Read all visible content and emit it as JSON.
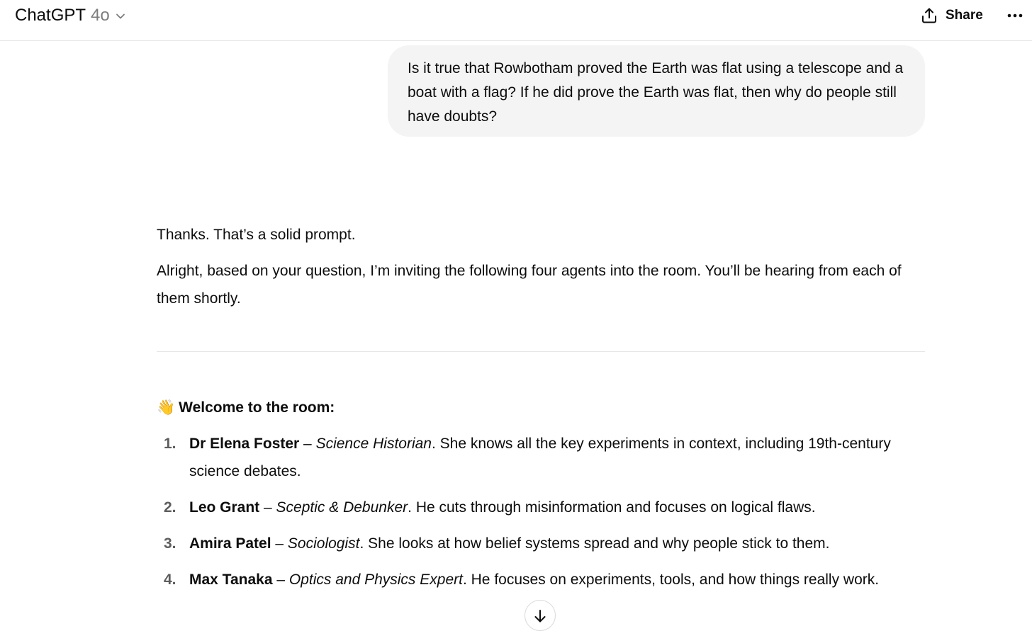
{
  "header": {
    "app_name": "ChatGPT",
    "model": "4o",
    "share_label": "Share",
    "icons": [
      "chevron-down-icon",
      "share-upload-icon",
      "more-dots-icon"
    ]
  },
  "user_message": "Is it true that Rowbotham proved the Earth was flat using a telescope and a boat with a flag? If he did prove the Earth was flat, then why do people still have doubts?",
  "assistant": {
    "para1": "Thanks. That’s a solid prompt.",
    "para2": "Alright, based on your question, I’m inviting the following four agents into the room. You’ll be hearing from each of them shortly.",
    "welcome_emoji": "👋",
    "welcome_heading": "Welcome to the room:",
    "agents": [
      {
        "number": "1.",
        "name": "Dr Elena Foster",
        "sep": " – ",
        "role": "Science Historian",
        "desc": ". She knows all the key experiments in context, including 19th-century science debates."
      },
      {
        "number": "2.",
        "name": "Leo Grant",
        "sep": " – ",
        "role": "Sceptic & Debunker",
        "desc": ". He cuts through misinformation and focuses on logical flaws."
      },
      {
        "number": "3.",
        "name": "Amira Patel",
        "sep": " – ",
        "role": "Sociologist",
        "desc": ". She looks at how belief systems spread and why people stick to them."
      },
      {
        "number": "4.",
        "name": "Max Tanaka",
        "sep": " – ",
        "role": "Optics and Physics Expert",
        "desc": ". He focuses on experiments, tools, and how things really work."
      }
    ]
  },
  "scroll_button_icon": "arrow-down-icon",
  "colors": {
    "text": "#0d0d0d",
    "muted": "#7d7d7d",
    "bubble_bg": "#f4f4f4",
    "divider": "#e5e5e5"
  }
}
